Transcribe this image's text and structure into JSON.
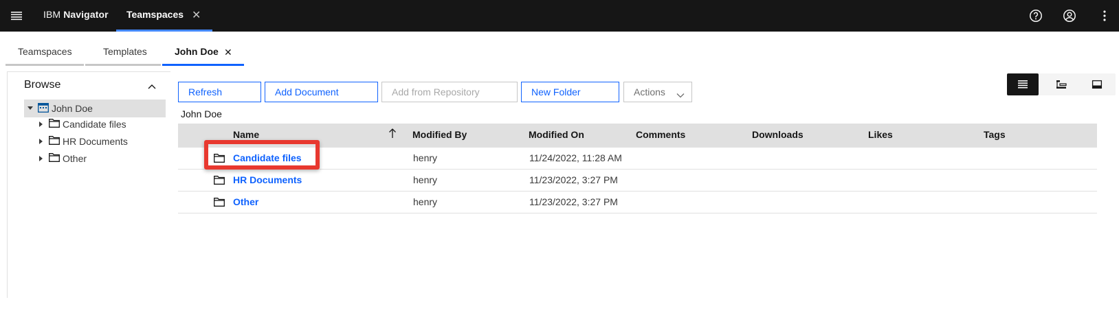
{
  "header": {
    "brand_prefix": "IBM",
    "brand_name": "Navigator",
    "active_tab": "Teamspaces",
    "close_glyph": "✕",
    "icons": [
      "menu-icon",
      "help-icon",
      "user-avatar-icon",
      "overflow-menu-icon"
    ]
  },
  "subtabs": [
    {
      "label": "Teamspaces"
    },
    {
      "label": "Templates"
    },
    {
      "label": "John Doe",
      "active": true,
      "close_glyph": "✕"
    }
  ],
  "browse": {
    "title": "Browse",
    "root": "John Doe",
    "children": [
      "Candidate files",
      "HR Documents",
      "Other"
    ]
  },
  "toolbar": {
    "refresh": "Refresh",
    "add_document": "Add Document",
    "add_from_repository": "Add from Repository",
    "new_folder": "New Folder",
    "actions": "Actions"
  },
  "breadcrumb": "John Doe",
  "table": {
    "columns": [
      "Name",
      "Modified By",
      "Modified On",
      "Comments",
      "Downloads",
      "Likes",
      "Tags"
    ],
    "rows": [
      {
        "name": "Candidate files",
        "modified_by": "henry",
        "modified_on": "11/24/2022, 11:28 AM"
      },
      {
        "name": "HR Documents",
        "modified_by": "henry",
        "modified_on": "11/23/2022, 3:27 PM"
      },
      {
        "name": "Other",
        "modified_by": "henry",
        "modified_on": "11/23/2022, 3:27 PM"
      }
    ]
  },
  "colors": {
    "header_bg": "#161616",
    "link_blue": "#0f62fe",
    "highlight_red": "#e8382f"
  }
}
